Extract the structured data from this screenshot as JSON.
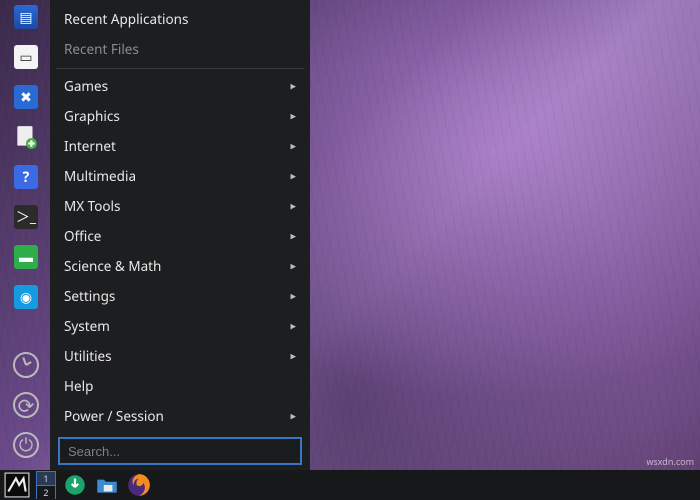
{
  "menu": {
    "recent_apps_label": "Recent Applications",
    "recent_files_label": "Recent Files",
    "categories": [
      {
        "label": "Games"
      },
      {
        "label": "Graphics"
      },
      {
        "label": "Internet"
      },
      {
        "label": "Multimedia"
      },
      {
        "label": "MX Tools"
      },
      {
        "label": "Office"
      },
      {
        "label": "Science & Math"
      },
      {
        "label": "Settings"
      },
      {
        "label": "System"
      },
      {
        "label": "Utilities"
      }
    ],
    "plain": [
      {
        "label": "Help"
      },
      {
        "label": "Power / Session",
        "has_submenu": true
      }
    ],
    "search_placeholder": "Search..."
  },
  "dock": {
    "icons": [
      "window-list-icon",
      "document-icon",
      "tools-icon",
      "add-file-icon",
      "help-icon",
      "terminal-icon",
      "file-manager-icon",
      "display-settings-icon"
    ],
    "session_icons": [
      "clock-icon",
      "sync-icon",
      "power-icon"
    ]
  },
  "pager": {
    "workspaces": [
      "1",
      "2"
    ]
  },
  "taskbar": {
    "items": [
      "mx-menu-icon",
      "updater-icon",
      "files-icon",
      "firefox-icon"
    ]
  },
  "watermark": "wsxdn.com"
}
